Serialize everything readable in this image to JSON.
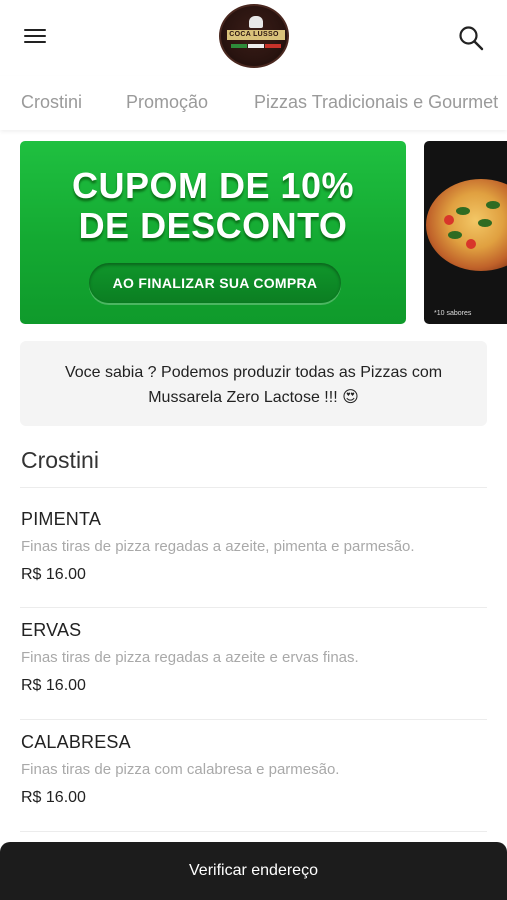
{
  "header": {
    "menu_icon": "hamburger-menu-icon",
    "logo_text": "COCA LUSSO",
    "search_icon": "search-icon"
  },
  "tabs": [
    {
      "label": "Crostini"
    },
    {
      "label": "Promoção"
    },
    {
      "label": "Pizzas Tradicionais e Gourmet"
    }
  ],
  "banners": [
    {
      "line1": "CUPOM DE 10%",
      "line2": "DE DESCONTO",
      "cta": "AO FINALIZAR SUA COMPRA",
      "color": "#14a932"
    },
    {
      "note": "*10 sabores"
    }
  ],
  "info_box": {
    "text": "Voce sabia ? Podemos produzir todas as Pizzas com Mussarela Zero Lactose !!! 😍"
  },
  "section": {
    "title": "Crostini",
    "items": [
      {
        "name": "PIMENTA",
        "description": "Finas tiras de pizza regadas a azeite, pimenta e parmesão.",
        "price": "R$ 16.00"
      },
      {
        "name": "ERVAS",
        "description": "Finas tiras de pizza regadas a azeite e ervas finas.",
        "price": "R$ 16.00"
      },
      {
        "name": "CALABRESA",
        "description": "Finas tiras de pizza com calabresa e parmesão.",
        "price": "R$ 16.00"
      }
    ]
  },
  "bottom_bar": {
    "label": "Verificar endereço",
    "color": "#1c1c1c"
  }
}
